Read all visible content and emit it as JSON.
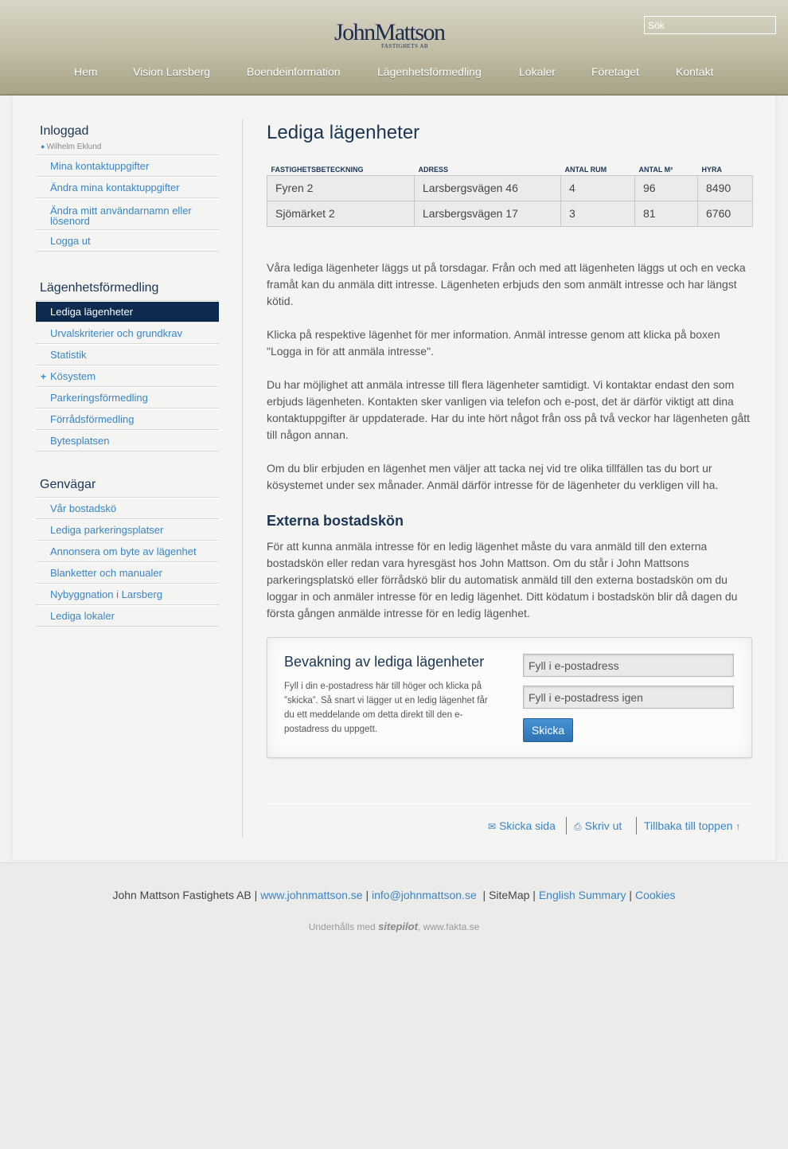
{
  "header": {
    "logo_name": "JohnMattson",
    "logo_sub": "FASTIGHETS AB",
    "search_placeholder": "Sök",
    "nav": [
      "Hem",
      "Vision Larsberg",
      "Boendeinformation",
      "Lägenhetsförmedling",
      "Lokaler",
      "Företaget",
      "Kontakt"
    ]
  },
  "sidebar": {
    "logged_in_heading": "Inloggad",
    "user_name": "Wilhelm Eklund",
    "account_items": [
      "Mina kontaktuppgifter",
      "Ändra mina kontaktuppgifter",
      "Ändra mitt användarnamn eller lösenord",
      "Logga ut"
    ],
    "section_heading": "Lägenhetsförmedling",
    "section_items": [
      "Lediga lägenheter",
      "Urvalskriterier och grundkrav",
      "Statistik",
      "Kösystem",
      "Parkeringsförmedling",
      "Förrådsförmedling",
      "Bytesplatsen"
    ],
    "shortcuts_heading": "Genvägar",
    "shortcut_items": [
      "Vår bostadskö",
      "Lediga parkeringsplatser",
      "Annonsera om byte av lägenhet",
      "Blanketter och manualer",
      "Nybyggnation i Larsberg",
      "Lediga lokaler"
    ]
  },
  "main": {
    "title": "Lediga lägenheter",
    "table": {
      "headers": [
        "Fastighetsbeteckning",
        "Adress",
        "Antal rum",
        "Antal m²",
        "Hyra"
      ],
      "rows": [
        [
          "Fyren 2",
          "Larsbergsvägen 46",
          "4",
          "96",
          "8490"
        ],
        [
          "Sjömärket 2",
          "Larsbergsvägen 17",
          "3",
          "81",
          "6760"
        ]
      ]
    },
    "paragraphs": [
      "Våra lediga lägenheter läggs ut på torsdagar. Från och med att lägenheten läggs ut och en vecka framåt kan du anmäla ditt intresse. Lägenheten erbjuds den som anmält intresse och har längst kötid.",
      "Klicka på respektive lägenhet för mer information. Anmäl intresse genom att klicka på boxen \"Logga in för att anmäla intresse\".",
      "Du har möjlighet att anmäla intresse till flera lägenheter samtidigt. Vi kontaktar endast den som erbjuds lägenheten. Kontakten sker vanligen via telefon och e-post, det är därför viktigt att dina kontaktuppgifter är uppdaterade. Har du inte hört något från oss på två veckor har lägenheten gått till någon annan.",
      "Om du blir erbjuden en lägenhet men väljer att tacka nej vid tre olika tillfällen tas du bort ur kösystemet under sex månader. Anmäl därför intresse för de lägenheter du verkligen vill ha."
    ],
    "subtitle": "Externa bostadskön",
    "external_text": "För att kunna anmäla intresse för en ledig lägenhet måste du vara anmäld till den externa bostadskön eller redan vara hyresgäst hos John Mattson. Om du står i John Mattsons parkeringsplatskö eller förrådskö blir du automatisk anmäld till den externa bostadskön om du loggar in och anmäler intresse för en ledig lägenhet. Ditt ködatum i bostadskön blir då dagen du första gången anmälde intresse för en ledig lägenhet.",
    "watch": {
      "title": "Bevakning av lediga lägenheter",
      "text": "Fyll i din e-postadress här till höger och klicka på ”skicka”. Så snart vi lägger ut en ledig lägenhet får du ett meddelande om detta direkt till den e-postadress du uppgett.",
      "email_placeholder": "Fyll i e-postadress",
      "email_again_placeholder": "Fyll i e-postadress igen",
      "submit_label": "Skicka"
    },
    "tools": {
      "send": "Skicka sida",
      "print": "Skriv ut",
      "top": "Tillbaka till toppen"
    }
  },
  "footer": {
    "company": "John Mattson Fastighets AB",
    "website": "www.johnmattson.se",
    "email": "info@johnmattson.se",
    "sitemap": "SiteMap",
    "english": "English Summary",
    "cookies": "Cookies",
    "credit_prefix": "Underhålls med",
    "credit_brand": "sitepilot",
    "credit_suffix": ", www.fakta.se"
  }
}
